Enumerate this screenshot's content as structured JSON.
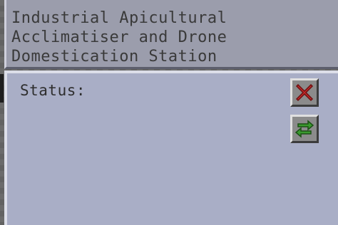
{
  "window": {
    "title_lines": [
      "Industrial Apicultural",
      "Acclimatiser and Drone",
      "Domestication Station"
    ]
  },
  "panel": {
    "status_label": "Status:"
  },
  "buttons": {
    "close": {
      "icon": "close-x-icon",
      "color": "#c42a2a"
    },
    "cycle": {
      "icon": "cycle-arrows-icon",
      "color": "#3a9a2e"
    }
  },
  "colors": {
    "title_bg": "#9b9dac",
    "panel_bg": "#a9aec6",
    "text": "#3a3a3a"
  }
}
